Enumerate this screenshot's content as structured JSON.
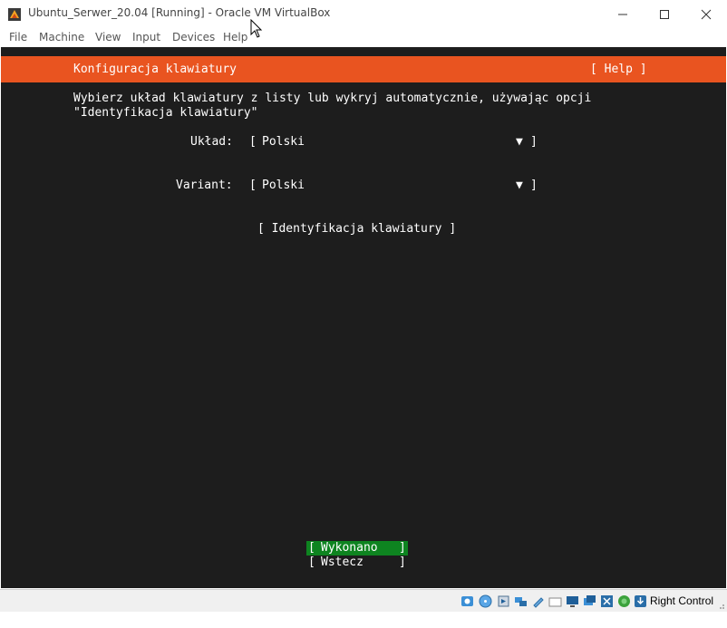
{
  "window": {
    "title": "Ubuntu_Serwer_20.04 [Running] - Oracle VM VirtualBox"
  },
  "menu": [
    {
      "label": "File"
    },
    {
      "label": "Machine"
    },
    {
      "label": "View"
    },
    {
      "label": "Input"
    },
    {
      "label": "Devices"
    },
    {
      "label": "Help"
    }
  ],
  "installer": {
    "header_title": "Konfiguracja klawiatury",
    "help_button": "[ Help ]",
    "description_line1": "Wybierz układ klawiatury z listy lub wykryj automatycznie, używając opcji",
    "description_line2": "\"Identyfikacja klawiatury\"",
    "layout_label": "Układ:",
    "layout_value": "Polski",
    "variant_label": "Variant:",
    "variant_value": "Polski",
    "bracket_open": "[",
    "bracket_close": "]",
    "dropdown_arrow": "▼",
    "identify_button": "[ Identyfikacja klawiatury ]",
    "done_button": "Wykonano",
    "back_button": "Wstecz"
  },
  "statusbar": {
    "host_key": "Right Control"
  },
  "colors": {
    "header_orange": "#e95420",
    "console_bg": "#1d1d1d",
    "done_green": "#0e8420"
  }
}
